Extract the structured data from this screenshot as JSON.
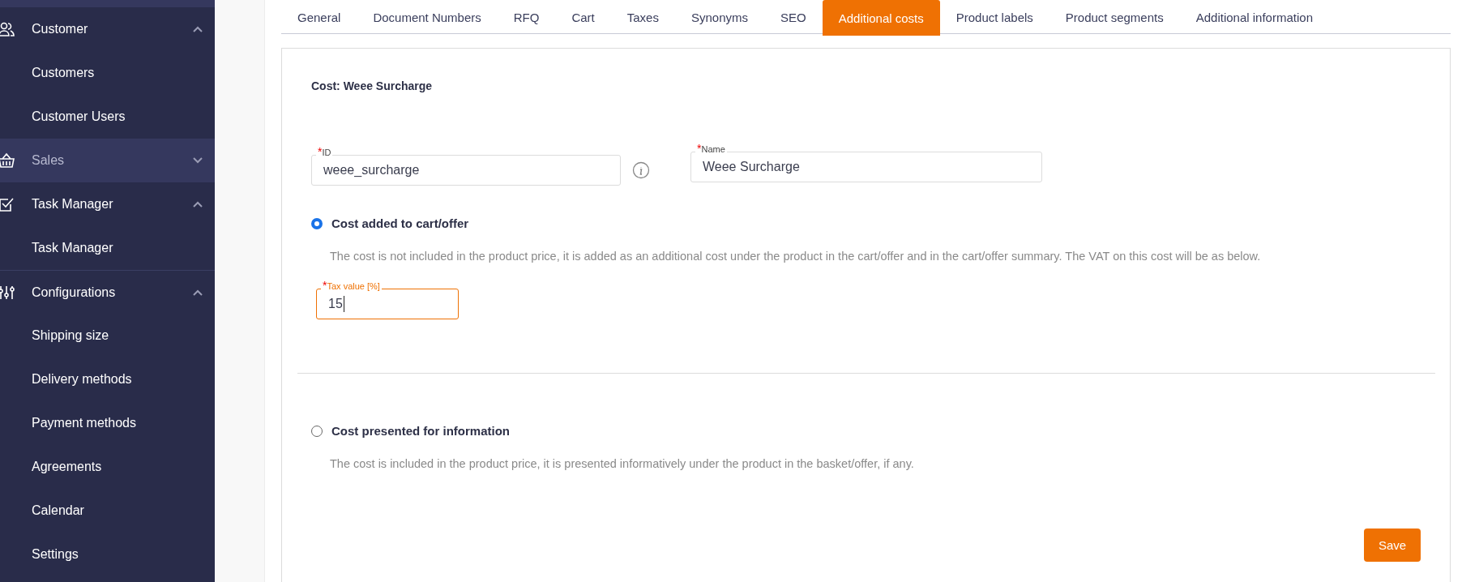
{
  "sidebar": {
    "items": [
      {
        "kind": "group",
        "label": "Customer",
        "expanded": true,
        "selected": false
      },
      {
        "kind": "item",
        "label": "Customers",
        "selected": false
      },
      {
        "kind": "item",
        "label": "Customer Users",
        "selected": false
      },
      {
        "kind": "group",
        "label": "Sales",
        "expanded": false,
        "selected": true
      },
      {
        "kind": "group",
        "label": "Task Manager",
        "expanded": true,
        "selected": false
      },
      {
        "kind": "item",
        "label": "Task Manager",
        "selected": false
      },
      {
        "kind": "group",
        "label": "Configurations",
        "expanded": true,
        "selected": false
      },
      {
        "kind": "item",
        "label": "Shipping size",
        "selected": false
      },
      {
        "kind": "item",
        "label": "Delivery methods",
        "selected": false
      },
      {
        "kind": "item",
        "label": "Payment methods",
        "selected": false
      },
      {
        "kind": "item",
        "label": "Agreements",
        "selected": false
      },
      {
        "kind": "item",
        "label": "Calendar",
        "selected": false
      },
      {
        "kind": "item",
        "label": "Settings",
        "selected": false
      }
    ]
  },
  "tabs": [
    {
      "label": "General",
      "selected": false
    },
    {
      "label": "Document Numbers",
      "selected": false
    },
    {
      "label": "RFQ",
      "selected": false
    },
    {
      "label": "Cart",
      "selected": false
    },
    {
      "label": "Taxes",
      "selected": false
    },
    {
      "label": "Synonyms",
      "selected": false
    },
    {
      "label": "SEO",
      "selected": false
    },
    {
      "label": "Additional costs",
      "selected": true
    },
    {
      "label": "Product labels",
      "selected": false
    },
    {
      "label": "Product segments",
      "selected": false
    },
    {
      "label": "Additional information",
      "selected": false
    }
  ],
  "form": {
    "title": "Cost: Weee Surcharge",
    "id_field": {
      "required_mark": "*",
      "label": "ID",
      "value": "weee_surcharge"
    },
    "name_field": {
      "required_mark": "*",
      "label": "Name",
      "value": "Weee Surcharge"
    },
    "options": [
      {
        "label": "Cost added to cart/offer",
        "selected": true,
        "description": "The cost is not included in the product price, it is added as an additional cost under the product in the cart/offer and in the cart/offer summary. The VAT on this cost will be as below.",
        "tax_field": {
          "required_mark": "*",
          "label": "Tax value [%]",
          "value": "15",
          "focused": true
        }
      },
      {
        "label": "Cost presented for information",
        "selected": false,
        "description": "The cost is included in the product price, it is presented informatively under the product in the basket/offer, if any."
      }
    ],
    "save_button": "Save"
  }
}
